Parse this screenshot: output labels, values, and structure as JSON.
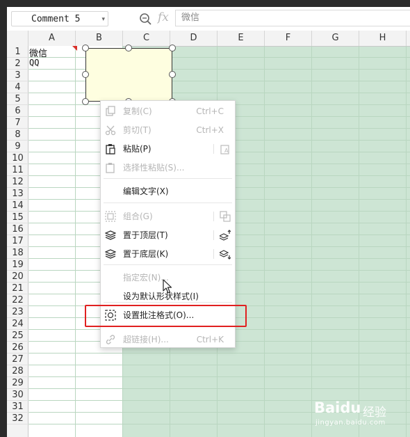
{
  "formula_bar": {
    "name_box": "Comment 5",
    "fx_label": "fx",
    "formula_value": "微信"
  },
  "sheet": {
    "columns": [
      "A",
      "B",
      "C",
      "D",
      "E",
      "F",
      "G",
      "H"
    ],
    "rows": [
      "1",
      "2",
      "3",
      "4",
      "5",
      "6",
      "7",
      "8",
      "9",
      "10",
      "11",
      "12",
      "13",
      "14",
      "15",
      "16",
      "17",
      "18",
      "19",
      "20",
      "21",
      "22",
      "23",
      "24",
      "25",
      "26",
      "27",
      "28",
      "29",
      "30",
      "31",
      "32"
    ],
    "cells": {
      "A1": "微信",
      "A2": "QQ"
    }
  },
  "context_menu": {
    "items": [
      {
        "label": "复制(C)",
        "shortcut": "Ctrl+C",
        "icon": "copy-icon",
        "disabled": true
      },
      {
        "label": "剪切(T)",
        "shortcut": "Ctrl+X",
        "icon": "cut-icon",
        "disabled": true
      },
      {
        "label": "粘贴(P)",
        "shortcut": "",
        "icon": "paste-icon",
        "right_icon": "paste-format-icon",
        "disabled": false
      },
      {
        "label": "选择性粘贴(S)...",
        "shortcut": "",
        "icon": "paste-special-icon",
        "disabled": true
      },
      {
        "label": "编辑文字(X)",
        "shortcut": "",
        "icon": "",
        "disabled": false
      },
      {
        "label": "组合(G)",
        "shortcut": "",
        "icon": "group-icon",
        "right_icon": "ungroup-icon",
        "disabled": true
      },
      {
        "label": "置于顶层(T)",
        "shortcut": "",
        "icon": "bring-to-front-icon",
        "right_icon": "bring-forward-icon",
        "disabled": false
      },
      {
        "label": "置于底层(K)",
        "shortcut": "",
        "icon": "send-to-back-icon",
        "right_icon": "send-backward-icon",
        "disabled": false
      },
      {
        "label": "指定宏(N)...",
        "shortcut": "",
        "icon": "",
        "disabled": true
      },
      {
        "label": "设为默认形状样式(I)",
        "shortcut": "",
        "icon": "",
        "disabled": false
      },
      {
        "label": "设置批注格式(O)...",
        "shortcut": "",
        "icon": "format-comment-icon",
        "disabled": false
      },
      {
        "label": "超链接(H)...",
        "shortcut": "Ctrl+K",
        "icon": "hyperlink-icon",
        "disabled": true
      }
    ]
  },
  "watermark": {
    "logo": "Baidu",
    "cn": "经验",
    "url": "jingyan.baidu.com"
  },
  "colors": {
    "grid_green": "#cde5d4",
    "highlight_red": "#e02020",
    "comment_fill": "#fefee0"
  }
}
